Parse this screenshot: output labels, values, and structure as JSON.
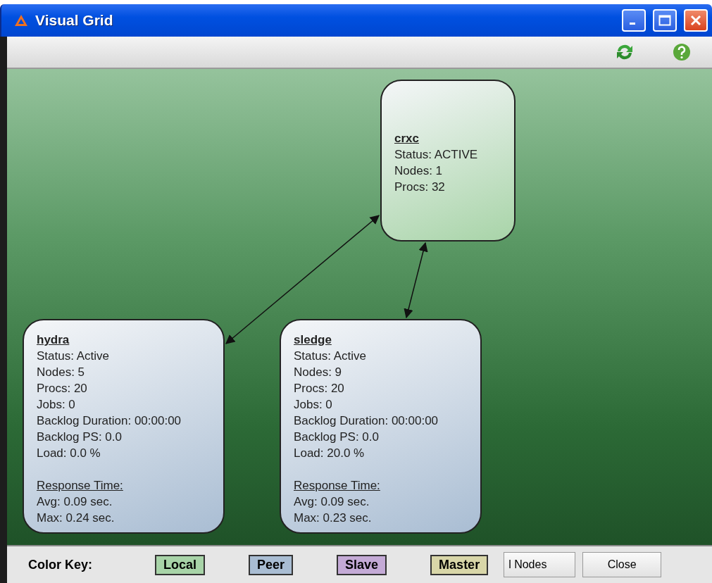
{
  "window": {
    "title": "Visual Grid"
  },
  "nodes": [
    {
      "name": "crxc",
      "color": "#a8d4a8",
      "lines": [
        "Status: ACTIVE",
        "Nodes: 1",
        "Procs: 32"
      ]
    },
    {
      "name": "hydra",
      "color": "#a9bdd3",
      "lines": [
        "Status: Active",
        "Nodes: 5",
        "Procs: 20",
        "Jobs: 0",
        "Backlog Duration: 00:00:00",
        "Backlog PS: 0.0",
        "Load: 0.0 %"
      ],
      "response": {
        "heading": "Response Time:",
        "lines": [
          "Avg: 0.09 sec.",
          "Max: 0.24 sec."
        ]
      }
    },
    {
      "name": "sledge",
      "color": "#a9bdd3",
      "lines": [
        "Status: Active",
        "Nodes: 9",
        "Procs: 20",
        "Jobs: 0",
        "Backlog Duration: 00:00:00",
        "Backlog PS: 0.0",
        "Load: 20.0 %"
      ],
      "response": {
        "heading": "Response Time:",
        "lines": [
          "Avg: 0.09 sec.",
          "Max: 0.23 sec."
        ]
      }
    }
  ],
  "color_key": {
    "label": "Color Key:",
    "items": [
      {
        "label": "Local",
        "color": "#a8d4a8"
      },
      {
        "label": "Peer",
        "color": "#a9bdd3"
      },
      {
        "label": "Slave",
        "color": "#c4aad6"
      },
      {
        "label": "Master",
        "color": "#d8d6a8"
      }
    ]
  },
  "buttons": [
    "l Nodes",
    "Close"
  ]
}
